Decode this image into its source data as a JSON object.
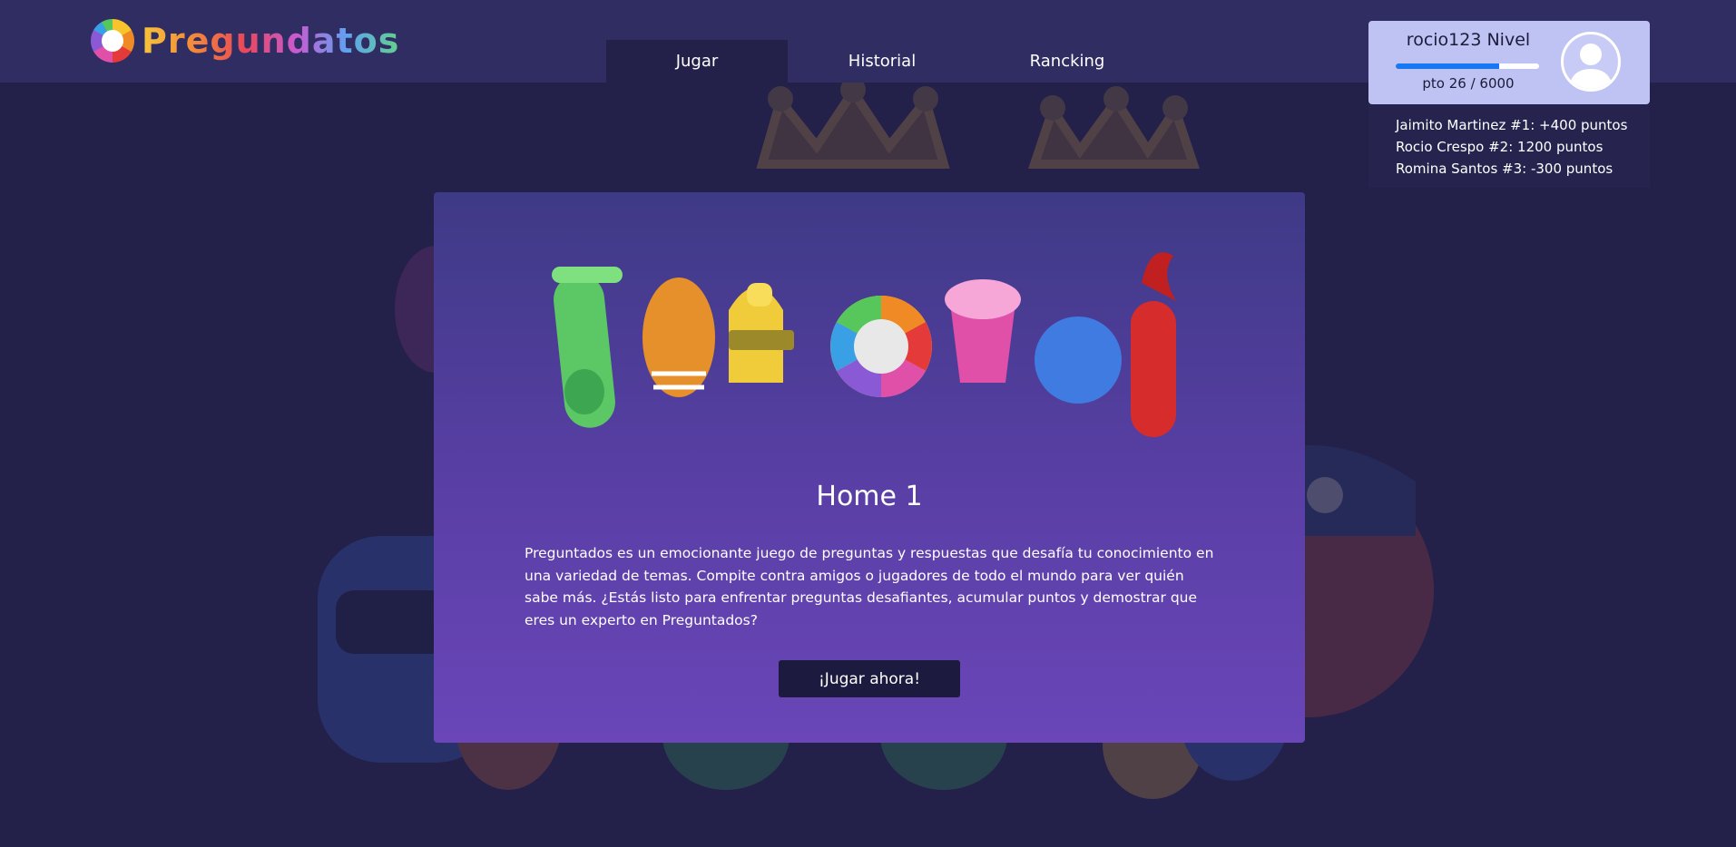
{
  "app": {
    "logo_text": "Pregundatos"
  },
  "nav": {
    "tabs": [
      {
        "label": "Jugar",
        "active": true
      },
      {
        "label": "Historial",
        "active": false
      },
      {
        "label": "Rancking",
        "active": false
      }
    ]
  },
  "user": {
    "name_level": "rocio123 Nivel",
    "points_label": "pto 26 / 6000",
    "progress_fraction": 0.72
  },
  "ranking": {
    "entries": [
      "Jaimito Martinez #1: +400 puntos",
      "Rocio Crespo #2: 1200 puntos",
      "Romina Santos #3: -300 puntos"
    ]
  },
  "main": {
    "title": "Home 1",
    "description": "Preguntados es un emocionante juego de preguntas y respuestas que desafía tu conocimiento en una variedad de temas. Compite contra amigos o jugadores de todo el mundo para ver quién sabe más. ¿Estás listo para enfrentar preguntas desafiantes, acumular puntos y demostrar que eres un experto en Preguntados?",
    "play_button": "¡Jugar ahora!"
  },
  "colors": {
    "background": "#23214a",
    "topbar": "#2f2d62",
    "user_card": "#bfc3f3",
    "progress": "#1877f2",
    "button": "#1c1a3e"
  }
}
